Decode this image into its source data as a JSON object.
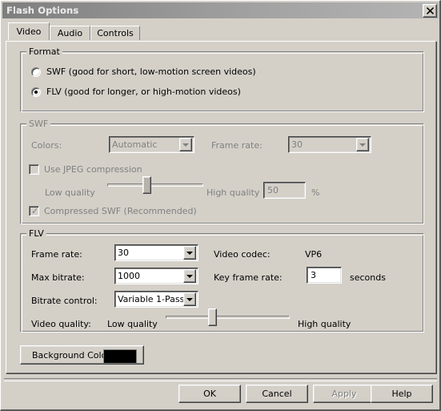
{
  "window": {
    "title": "Flash Options",
    "close_label": "✕"
  },
  "tabs": [
    {
      "label": "Video",
      "selected": true
    },
    {
      "label": "Audio",
      "selected": false
    },
    {
      "label": "Controls",
      "selected": false
    }
  ],
  "format_group": {
    "title": "Format",
    "options": [
      {
        "label": "SWF (good for short, low-motion screen videos)",
        "selected": false
      },
      {
        "label": "FLV (good for longer, or high-motion videos)",
        "selected": true
      }
    ]
  },
  "swf_group": {
    "title": "SWF",
    "enabled": false,
    "colors_label": "Colors:",
    "colors_value": "Automatic",
    "frame_rate_label": "Frame rate:",
    "frame_rate_value": "30",
    "use_jpeg_label": "Use JPEG compression",
    "use_jpeg_checked": false,
    "low_quality_label": "Low quality",
    "high_quality_label": "High quality",
    "quality_value": "50",
    "percent_label": "%",
    "quality_slider_percent": 40,
    "compressed_swf_label": "Compressed SWF (Recommended)",
    "compressed_swf_checked": true
  },
  "flv_group": {
    "title": "FLV",
    "frame_rate_label": "Frame rate:",
    "frame_rate_value": "30",
    "max_bitrate_label": "Max bitrate:",
    "max_bitrate_value": "1000",
    "bitrate_control_label": "Bitrate control:",
    "bitrate_control_value": "Variable 1-Pass",
    "video_codec_label": "Video codec:",
    "video_codec_value": "VP6",
    "key_frame_rate_label": "Key frame rate:",
    "key_frame_rate_value": "3",
    "seconds_label": "seconds",
    "video_quality_label": "Video quality:",
    "low_quality_label": "Low quality",
    "high_quality_label": "High quality",
    "video_quality_slider_percent": 37
  },
  "background_color": {
    "label": "Background Color...",
    "swatch_hex": "#000000"
  },
  "footer": {
    "ok_label": "OK",
    "cancel_label": "Cancel",
    "apply_label": "Apply",
    "apply_enabled": false,
    "help_label": "Help"
  }
}
